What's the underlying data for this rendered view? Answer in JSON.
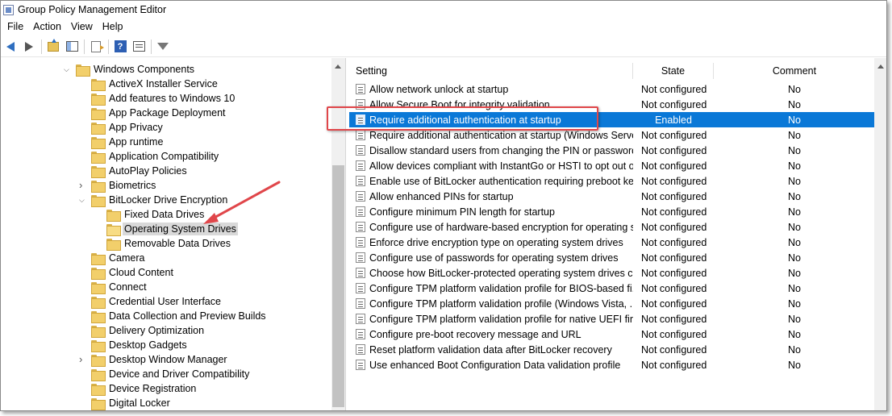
{
  "window": {
    "title": "Group Policy Management Editor"
  },
  "menu": [
    "File",
    "Action",
    "View",
    "Help"
  ],
  "toolbar": {
    "icons": [
      "back-arrow-icon",
      "forward-arrow-icon",
      "up-folder-icon",
      "show-hide-pane-icon",
      "export-list-icon",
      "help-icon",
      "properties-icon",
      "filter-icon"
    ],
    "help_glyph": "?"
  },
  "tree": [
    {
      "label": "Windows Components",
      "level": 0,
      "expander": "open"
    },
    {
      "label": "ActiveX Installer Service",
      "level": 1,
      "expander": ""
    },
    {
      "label": "Add features to Windows 10",
      "level": 1,
      "expander": ""
    },
    {
      "label": "App Package Deployment",
      "level": 1,
      "expander": ""
    },
    {
      "label": "App Privacy",
      "level": 1,
      "expander": ""
    },
    {
      "label": "App runtime",
      "level": 1,
      "expander": ""
    },
    {
      "label": "Application Compatibility",
      "level": 1,
      "expander": ""
    },
    {
      "label": "AutoPlay Policies",
      "level": 1,
      "expander": ""
    },
    {
      "label": "Biometrics",
      "level": 1,
      "expander": "closed"
    },
    {
      "label": "BitLocker Drive Encryption",
      "level": 1,
      "expander": "open"
    },
    {
      "label": "Fixed Data Drives",
      "level": 2,
      "expander": ""
    },
    {
      "label": "Operating System Drives",
      "level": 2,
      "expander": "",
      "selected": true
    },
    {
      "label": "Removable Data Drives",
      "level": 2,
      "expander": ""
    },
    {
      "label": "Camera",
      "level": 1,
      "expander": ""
    },
    {
      "label": "Cloud Content",
      "level": 1,
      "expander": ""
    },
    {
      "label": "Connect",
      "level": 1,
      "expander": ""
    },
    {
      "label": "Credential User Interface",
      "level": 1,
      "expander": ""
    },
    {
      "label": "Data Collection and Preview Builds",
      "level": 1,
      "expander": ""
    },
    {
      "label": "Delivery Optimization",
      "level": 1,
      "expander": ""
    },
    {
      "label": "Desktop Gadgets",
      "level": 1,
      "expander": ""
    },
    {
      "label": "Desktop Window Manager",
      "level": 1,
      "expander": "closed"
    },
    {
      "label": "Device and Driver Compatibility",
      "level": 1,
      "expander": ""
    },
    {
      "label": "Device Registration",
      "level": 1,
      "expander": ""
    },
    {
      "label": "Digital Locker",
      "level": 1,
      "expander": ""
    }
  ],
  "columns": {
    "setting": "Setting",
    "state": "State",
    "comment": "Comment"
  },
  "policies": [
    {
      "setting": "Allow network unlock at startup",
      "state": "Not configured",
      "comment": "No"
    },
    {
      "setting": "Allow Secure Boot for integrity validation",
      "state": "Not configured",
      "comment": "No"
    },
    {
      "setting": "Require additional authentication at startup",
      "state": "Enabled",
      "comment": "No",
      "selected": true
    },
    {
      "setting": "Require additional authentication at startup (Windows Serve...",
      "state": "Not configured",
      "comment": "No"
    },
    {
      "setting": "Disallow standard users from changing the PIN or password",
      "state": "Not configured",
      "comment": "No"
    },
    {
      "setting": "Allow devices compliant with InstantGo or HSTI to opt out o...",
      "state": "Not configured",
      "comment": "No"
    },
    {
      "setting": "Enable use of BitLocker authentication requiring preboot ke...",
      "state": "Not configured",
      "comment": "No"
    },
    {
      "setting": "Allow enhanced PINs for startup",
      "state": "Not configured",
      "comment": "No"
    },
    {
      "setting": "Configure minimum PIN length for startup",
      "state": "Not configured",
      "comment": "No"
    },
    {
      "setting": "Configure use of hardware-based encryption for operating s...",
      "state": "Not configured",
      "comment": "No"
    },
    {
      "setting": "Enforce drive encryption type on operating system drives",
      "state": "Not configured",
      "comment": "No"
    },
    {
      "setting": "Configure use of passwords for operating system drives",
      "state": "Not configured",
      "comment": "No"
    },
    {
      "setting": "Choose how BitLocker-protected operating system drives ca...",
      "state": "Not configured",
      "comment": "No"
    },
    {
      "setting": "Configure TPM platform validation profile for BIOS-based fi...",
      "state": "Not configured",
      "comment": "No"
    },
    {
      "setting": "Configure TPM platform validation profile (Windows Vista, ...",
      "state": "Not configured",
      "comment": "No"
    },
    {
      "setting": "Configure TPM platform validation profile for native UEFI fir...",
      "state": "Not configured",
      "comment": "No"
    },
    {
      "setting": "Configure pre-boot recovery message and URL",
      "state": "Not configured",
      "comment": "No"
    },
    {
      "setting": "Reset platform validation data after BitLocker recovery",
      "state": "Not configured",
      "comment": "No"
    },
    {
      "setting": "Use enhanced Boot Configuration Data validation profile",
      "state": "Not configured",
      "comment": "No"
    }
  ],
  "annotation": {
    "color": "#e0464a"
  }
}
